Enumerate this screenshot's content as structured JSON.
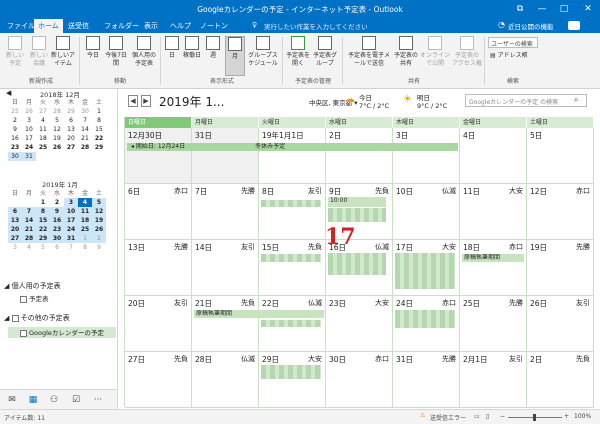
{
  "window": {
    "title": "Googleカレンダーの予定 - インターネット予定表 - Outlook",
    "restore": "⧉",
    "minimize": "—",
    "maximize": "□",
    "close": "✕"
  },
  "menu": {
    "items": [
      "ファイル",
      "ホーム",
      "送受信",
      "フォルダー",
      "表示",
      "ヘルプ",
      "ノートン"
    ],
    "tellme": "実行したい作業を入力してください",
    "search_recent": "近日公開の機能"
  },
  "ribbon": {
    "buttons": [
      "新しい予定",
      "新しい会議",
      "新しいアイテム",
      "今日",
      "今後7日間",
      "個人用の予定表",
      "日",
      "稼働日",
      "週",
      "月",
      "グループスケジュール",
      "予定表を開く",
      "予定表グループ",
      "予定表を電子メールで送信",
      "予定表の共有",
      "オンラインで公開",
      "予定表のアクセス権"
    ],
    "groups": [
      "新規作成",
      "移動",
      "表示形式",
      "予定表の管理",
      "共有",
      "検索"
    ],
    "search_people": "ユーザーの検索",
    "address_book": "アドレス帳"
  },
  "sidebar": {
    "dec_title": "2018年 12月",
    "jan_title": "2019年 1月",
    "weekdays": [
      "日",
      "月",
      "火",
      "水",
      "木",
      "金",
      "土"
    ],
    "dec_days": [
      "25",
      "26",
      "27",
      "28",
      "29",
      "30",
      "1",
      "2",
      "3",
      "4",
      "5",
      "6",
      "7",
      "8",
      "9",
      "10",
      "11",
      "12",
      "13",
      "14",
      "15",
      "16",
      "17",
      "18",
      "19",
      "20",
      "21",
      "22",
      "23",
      "24",
      "25",
      "26",
      "27",
      "28",
      "29",
      "30",
      "31"
    ],
    "jan_days": [
      "",
      "",
      "1",
      "2",
      "3",
      "4",
      "5",
      "6",
      "7",
      "8",
      "9",
      "10",
      "11",
      "12",
      "13",
      "14",
      "15",
      "16",
      "17",
      "18",
      "19",
      "20",
      "21",
      "22",
      "23",
      "24",
      "25",
      "26",
      "27",
      "28",
      "29",
      "30",
      "31",
      "1",
      "2",
      "3",
      "4",
      "5",
      "6",
      "7",
      "8",
      "9"
    ],
    "group_personal": "個人用の予定表",
    "item_calendar": "予定表",
    "group_other": "その他の予定表",
    "item_google": "Googleカレンダーの予定"
  },
  "nav": {
    "icons": [
      "mail-icon",
      "calendar-icon",
      "people-icon",
      "tasks-icon",
      "more-icon"
    ]
  },
  "calendar": {
    "title": "2019年 1...",
    "location": "中央区, 東京都",
    "weather": [
      {
        "label": "今日",
        "temp": "7°C / 2°C"
      },
      {
        "label": "明日",
        "temp": "9°C / 2°C"
      }
    ],
    "search_placeholder": "Googleカレンダーの予定 の検索",
    "weekday_headers": [
      "日曜日",
      "月曜日",
      "火曜日",
      "水曜日",
      "木曜日",
      "金曜日",
      "土曜日"
    ],
    "weeks": [
      [
        {
          "d": "12月30日",
          "r": "",
          "g": true
        },
        {
          "d": "31日",
          "r": "",
          "g": true
        },
        {
          "d": "19年1月1日",
          "r": ""
        },
        {
          "d": "2日",
          "r": ""
        },
        {
          "d": "3日",
          "r": ""
        },
        {
          "d": "4日",
          "r": ""
        },
        {
          "d": "5日",
          "r": ""
        }
      ],
      [
        {
          "d": "6日",
          "r": "赤口"
        },
        {
          "d": "7日",
          "r": "先勝"
        },
        {
          "d": "8日",
          "r": "友引"
        },
        {
          "d": "9日",
          "r": "先負"
        },
        {
          "d": "10日",
          "r": "仏滅"
        },
        {
          "d": "11日",
          "r": "大安"
        },
        {
          "d": "12日",
          "r": "赤口"
        }
      ],
      [
        {
          "d": "13日",
          "r": "先勝"
        },
        {
          "d": "14日",
          "r": "友引"
        },
        {
          "d": "15日",
          "r": "先負"
        },
        {
          "d": "16日",
          "r": "仏滅"
        },
        {
          "d": "17日",
          "r": "大安"
        },
        {
          "d": "18日",
          "r": "赤口"
        },
        {
          "d": "19日",
          "r": "先勝"
        }
      ],
      [
        {
          "d": "20日",
          "r": "友引"
        },
        {
          "d": "21日",
          "r": "先負"
        },
        {
          "d": "22日",
          "r": "仏滅"
        },
        {
          "d": "23日",
          "r": "大安"
        },
        {
          "d": "24日",
          "r": "赤口"
        },
        {
          "d": "25日",
          "r": "先勝"
        },
        {
          "d": "26日",
          "r": "友引"
        }
      ],
      [
        {
          "d": "27日",
          "r": "先負"
        },
        {
          "d": "28日",
          "r": "仏滅"
        },
        {
          "d": "29日",
          "r": "大安"
        },
        {
          "d": "30日",
          "r": "赤口"
        },
        {
          "d": "31日",
          "r": "先勝"
        },
        {
          "d": "2月1日",
          "r": "友引"
        },
        {
          "d": "2日",
          "r": "先負"
        }
      ]
    ],
    "holiday_start": "開始日: 12月24日",
    "holiday_label": "冬休み予定",
    "event_time": "10:00",
    "event_period": "原稿執筆期間",
    "annotation": "17"
  },
  "status": {
    "items": "アイテム数: 11",
    "error": "送受信エラー",
    "zoom": "100%"
  }
}
